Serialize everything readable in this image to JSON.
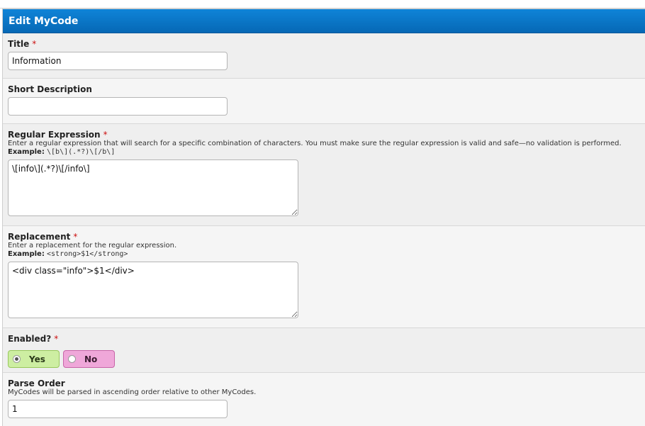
{
  "header": {
    "title": "Edit MyCode"
  },
  "required_mark": "*",
  "fields": {
    "title": {
      "label": "Title",
      "value": "Information"
    },
    "short_description": {
      "label": "Short Description",
      "value": ""
    },
    "regex": {
      "label": "Regular Expression",
      "description": "Enter a regular expression that will search for a specific combination of characters. You must make sure the regular expression is valid and safe—no validation is performed.",
      "example_label": "Example:",
      "example_value": "\\[b\\](.*?)\\[/b\\]",
      "value": "\\[info\\](.*?)\\[/info\\]"
    },
    "replacement": {
      "label": "Replacement",
      "description": "Enter a replacement for the regular expression.",
      "example_label": "Example:",
      "example_value": "<strong>$1</strong>",
      "value": "<div class=\"info\">$1</div>"
    },
    "enabled": {
      "label": "Enabled?",
      "yes_label": "Yes",
      "no_label": "No",
      "selected": "Yes"
    },
    "parse_order": {
      "label": "Parse Order",
      "description": "MyCodes will be parsed in ascending order relative to other MyCodes.",
      "value": "1"
    }
  },
  "colors": {
    "header_bg": "#0a78c8",
    "yes_bg": "#cdeea2",
    "no_bg": "#efa7d9",
    "required": "#cc1111"
  }
}
